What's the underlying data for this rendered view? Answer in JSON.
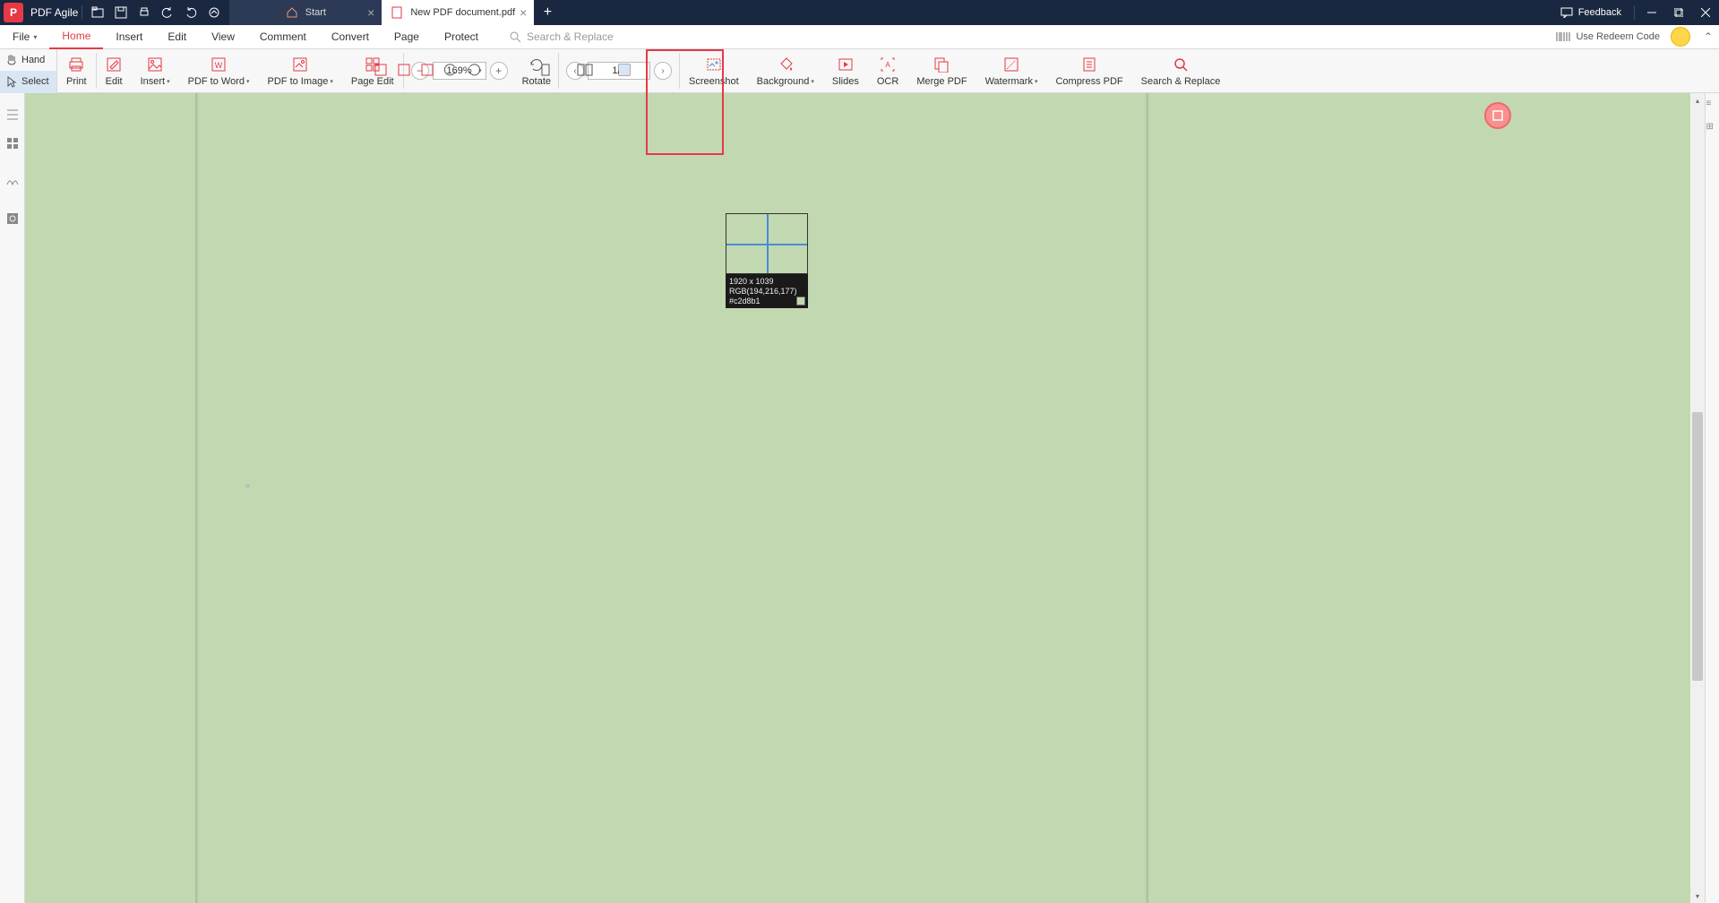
{
  "app": {
    "title": "PDF Agile"
  },
  "titlebar": {
    "feedback": "Feedback",
    "tabs": [
      {
        "label": "Start",
        "active": false
      },
      {
        "label": "New PDF document.pdf",
        "active": true
      }
    ]
  },
  "menu": {
    "items": [
      "File",
      "Home",
      "Insert",
      "Edit",
      "View",
      "Comment",
      "Convert",
      "Page",
      "Protect"
    ],
    "active": "Home",
    "search_placeholder": "Search & Replace",
    "redeem": "Use Redeem Code"
  },
  "ribbon": {
    "modes": {
      "hand": "Hand",
      "select": "Select"
    },
    "print": "Print",
    "edit": "Edit",
    "insert": "Insert",
    "pdf_to_word": "PDF to Word",
    "pdf_to_image": "PDF to Image",
    "page_edit": "Page Edit",
    "rotate": "Rotate",
    "screenshot": "Screenshot",
    "background": "Background",
    "slides": "Slides",
    "ocr": "OCR",
    "merge_pdf": "Merge PDF",
    "watermark": "Watermark",
    "compress_pdf": "Compress PDF",
    "search_replace": "Search & Replace",
    "zoom_value": "169%",
    "page_value": "1/1"
  },
  "magnifier": {
    "dims": "1920 x 1039",
    "rgb": "RGB(194,216,177)",
    "hex": "#c2d8b1"
  },
  "colors": {
    "accent": "#e63946",
    "titlebar": "#1a2740",
    "canvas": "#c2d8b1"
  }
}
